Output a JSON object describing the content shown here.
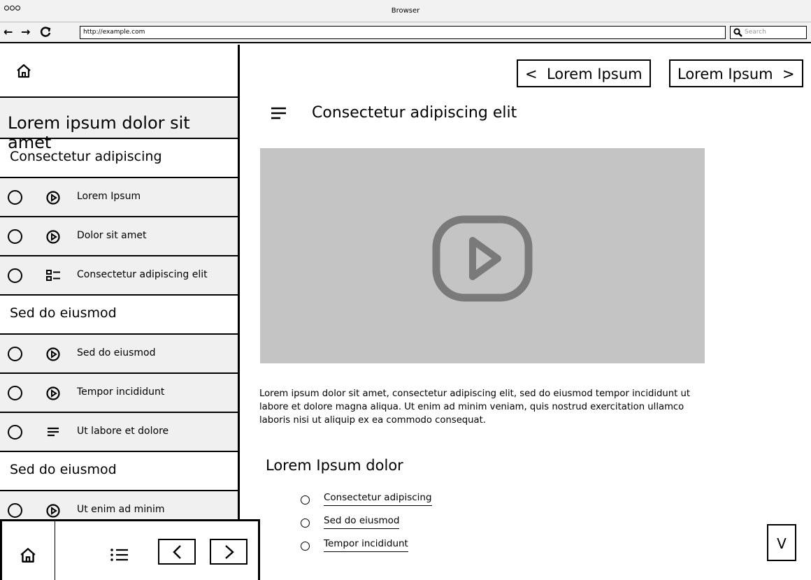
{
  "browser": {
    "title": "Browser",
    "url": "http://example.com",
    "search_placeholder": "Search"
  },
  "sidebar": {
    "title": "Lorem ipsum dolor sit amet",
    "sections": [
      {
        "label": "Consectetur adipiscing",
        "items": [
          {
            "icon": "play-icon",
            "label": "Lorem Ipsum"
          },
          {
            "icon": "play-icon",
            "label": "Dolor sit amet"
          },
          {
            "icon": "quiz-icon",
            "label": "Consectetur adipiscing elit"
          }
        ]
      },
      {
        "label": "Sed do eiusmod",
        "items": [
          {
            "icon": "play-icon",
            "label": "Sed do eiusmod"
          },
          {
            "icon": "play-icon",
            "label": "Tempor incididunt"
          },
          {
            "icon": "text-icon",
            "label": "Ut labore et dolore"
          }
        ]
      },
      {
        "label": "Sed do eiusmod",
        "items": [
          {
            "icon": "play-icon",
            "label": "Ut enim ad minim"
          }
        ]
      }
    ]
  },
  "top_nav": {
    "prev_label": "Lorem Ipsum",
    "next_label": "Lorem Ipsum"
  },
  "main": {
    "title": "Consectetur adipiscing elit",
    "body": "Lorem ipsum dolor sit amet, consectetur adipiscing elit, sed do eiusmod tempor incididunt ut labore et dolore magna aliqua. Ut enim ad minim veniam, quis nostrud exercitation ullamco laboris nisi ut aliquip ex ea commodo consequat.",
    "subheading": "Lorem Ipsum dolor",
    "links": [
      "Consectetur adipiscing",
      "Sed do eiusmod",
      "Tempor incididunt"
    ],
    "scroll_label": "V"
  }
}
